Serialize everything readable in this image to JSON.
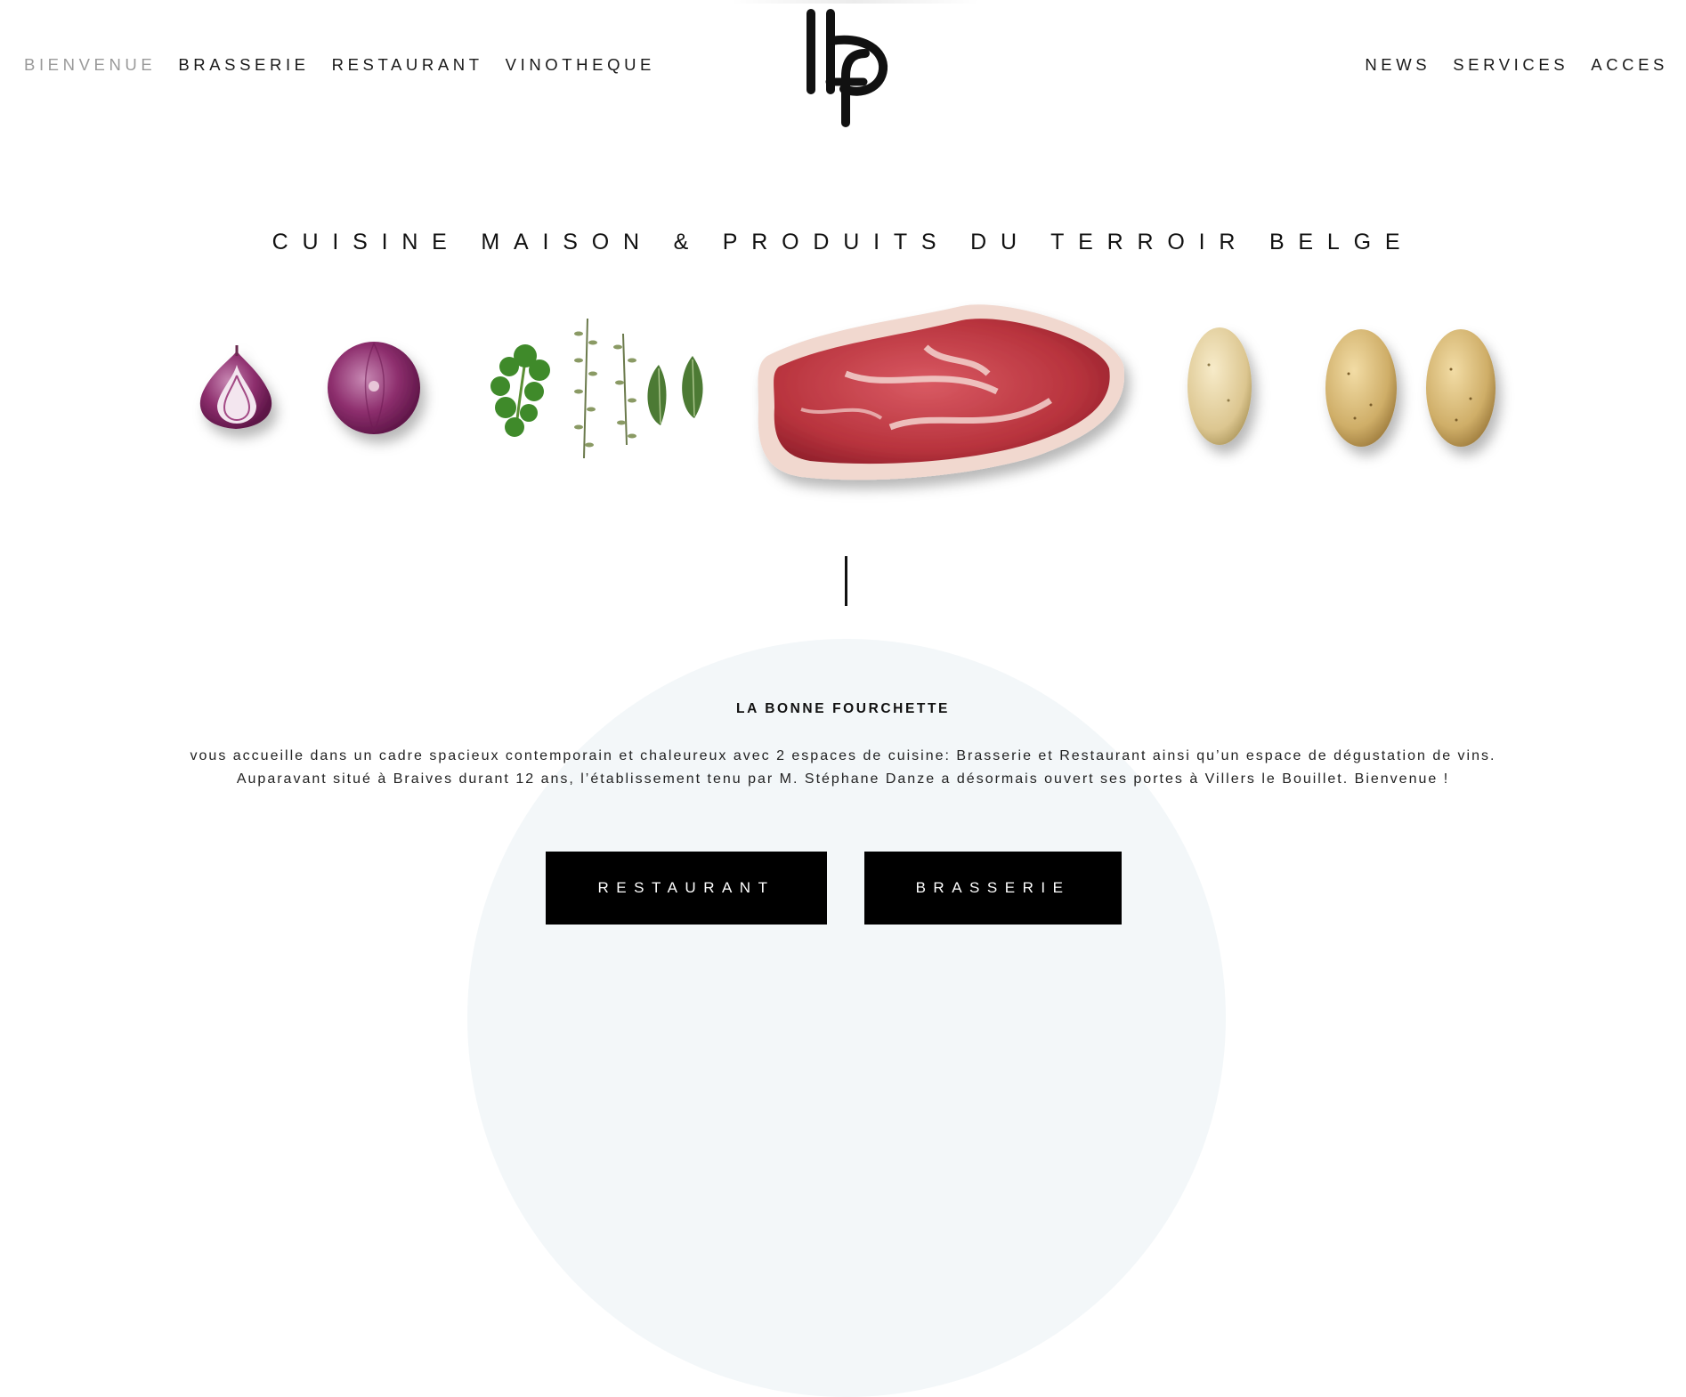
{
  "nav": {
    "left": [
      "BIENVENUE",
      "BRASSERIE",
      "RESTAURANT",
      "VINOTHEQUE"
    ],
    "right": [
      "NEWS",
      "SERVICES",
      "ACCES"
    ],
    "active": "BIENVENUE"
  },
  "logo": {
    "icon": "lbf-monogram-logo"
  },
  "hero": {
    "tagline": "CUISINE MAISON & PRODUITS DU TERROIR BELGE",
    "ingredients": [
      "onion-half",
      "red-onion",
      "cilantro",
      "thyme-sprigs",
      "bay-leaves",
      "raw-beef-steak",
      "potato",
      "potato",
      "potato"
    ]
  },
  "about": {
    "title": "LA BONNE FOURCHETTE",
    "line1": "vous accueille dans un cadre spacieux contemporain et chaleureux avec 2 espaces de cuisine: Brasserie et Restaurant ainsi qu’un espace de dégustation de vins.",
    "line2": "Auparavant situé à Braives durant 12 ans, l’établissement tenu par M. Stéphane Danze a désormais ouvert ses portes à Villers le Bouillet. Bienvenue !"
  },
  "buttons": {
    "restaurant": "RESTAURANT",
    "brasserie": "BRASSERIE"
  },
  "colors": {
    "nav_active": "#9a9a9a",
    "arc_bg": "#f3f7f9",
    "button_bg": "#000000",
    "text": "#111111"
  }
}
